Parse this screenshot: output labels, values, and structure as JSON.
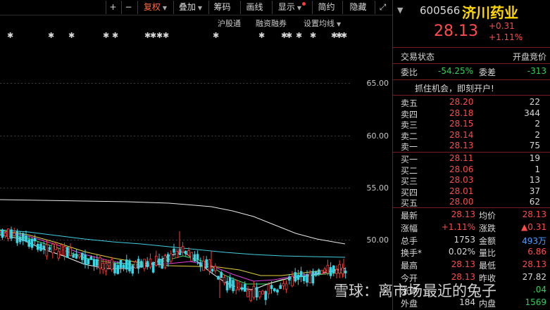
{
  "toolbar": {
    "plus": "+",
    "minus": "−",
    "fuquan": "复权",
    "diejia": "叠加",
    "chouma": "筹码",
    "huaxian": "画线",
    "xianshi": "显示",
    "jiangou": "简约",
    "yincang": "隐藏",
    "expand_icon": "⤢"
  },
  "subbar": {
    "hugutong": "沪股通",
    "rongzi": "融资融券",
    "shezhi": "设置均线"
  },
  "price_axis": [
    "65.00",
    "60.00",
    "55.00",
    "50.00"
  ],
  "quote": {
    "code": "600566",
    "name": "济川药业",
    "price": "28.13",
    "change": "+0.31",
    "change_pct": "+1.11%",
    "trade_status_label": "交易状态",
    "trade_status_value": "开盘竞价",
    "weibi_label": "委比",
    "weibi_value": "-54.25%",
    "weicha_label": "委差",
    "weicha_value": "-313",
    "banner": "抓住机会，即刻开户!"
  },
  "asks": [
    {
      "label": "卖五",
      "price": "28.20",
      "volume": "22"
    },
    {
      "label": "卖四",
      "price": "28.18",
      "volume": "344"
    },
    {
      "label": "卖三",
      "price": "28.15",
      "volume": "2"
    },
    {
      "label": "卖二",
      "price": "28.14",
      "volume": "2"
    },
    {
      "label": "卖一",
      "price": "28.13",
      "volume": "75"
    }
  ],
  "bids": [
    {
      "label": "买一",
      "price": "28.11",
      "volume": "19"
    },
    {
      "label": "买二",
      "price": "28.06",
      "volume": "1"
    },
    {
      "label": "买三",
      "price": "28.03",
      "volume": "13"
    },
    {
      "label": "买四",
      "price": "28.01",
      "volume": "37"
    },
    {
      "label": "买五",
      "price": "28.00",
      "volume": "62"
    }
  ],
  "stats": [
    {
      "l1": "最新",
      "v1": "28.13",
      "l2": "均价",
      "v2": "28.13"
    },
    {
      "l1": "涨幅",
      "v1": "+1.11%",
      "l2": "涨跌",
      "v2": "▲0.31"
    },
    {
      "l1": "总手",
      "v1": "1753",
      "l2": "金额",
      "v2": "493万"
    },
    {
      "l1": "换手*",
      "v1": "0.02%",
      "l2": "量比",
      "v2": "6.86"
    },
    {
      "l1": "最高",
      "v1": "28.13",
      "l2": "最低",
      "v2": "28.13"
    },
    {
      "l1": "今开",
      "v1": "28.13",
      "l2": "昨收",
      "v2": "27.82"
    },
    {
      "l1": "涨停",
      "v1": "",
      "l2": "",
      "v2": ".04"
    },
    {
      "l1": "外盘",
      "v1": "184",
      "l2": "内盘",
      "v2": "1569"
    }
  ],
  "watermark": "雪球：离市场最近的兔子"
}
